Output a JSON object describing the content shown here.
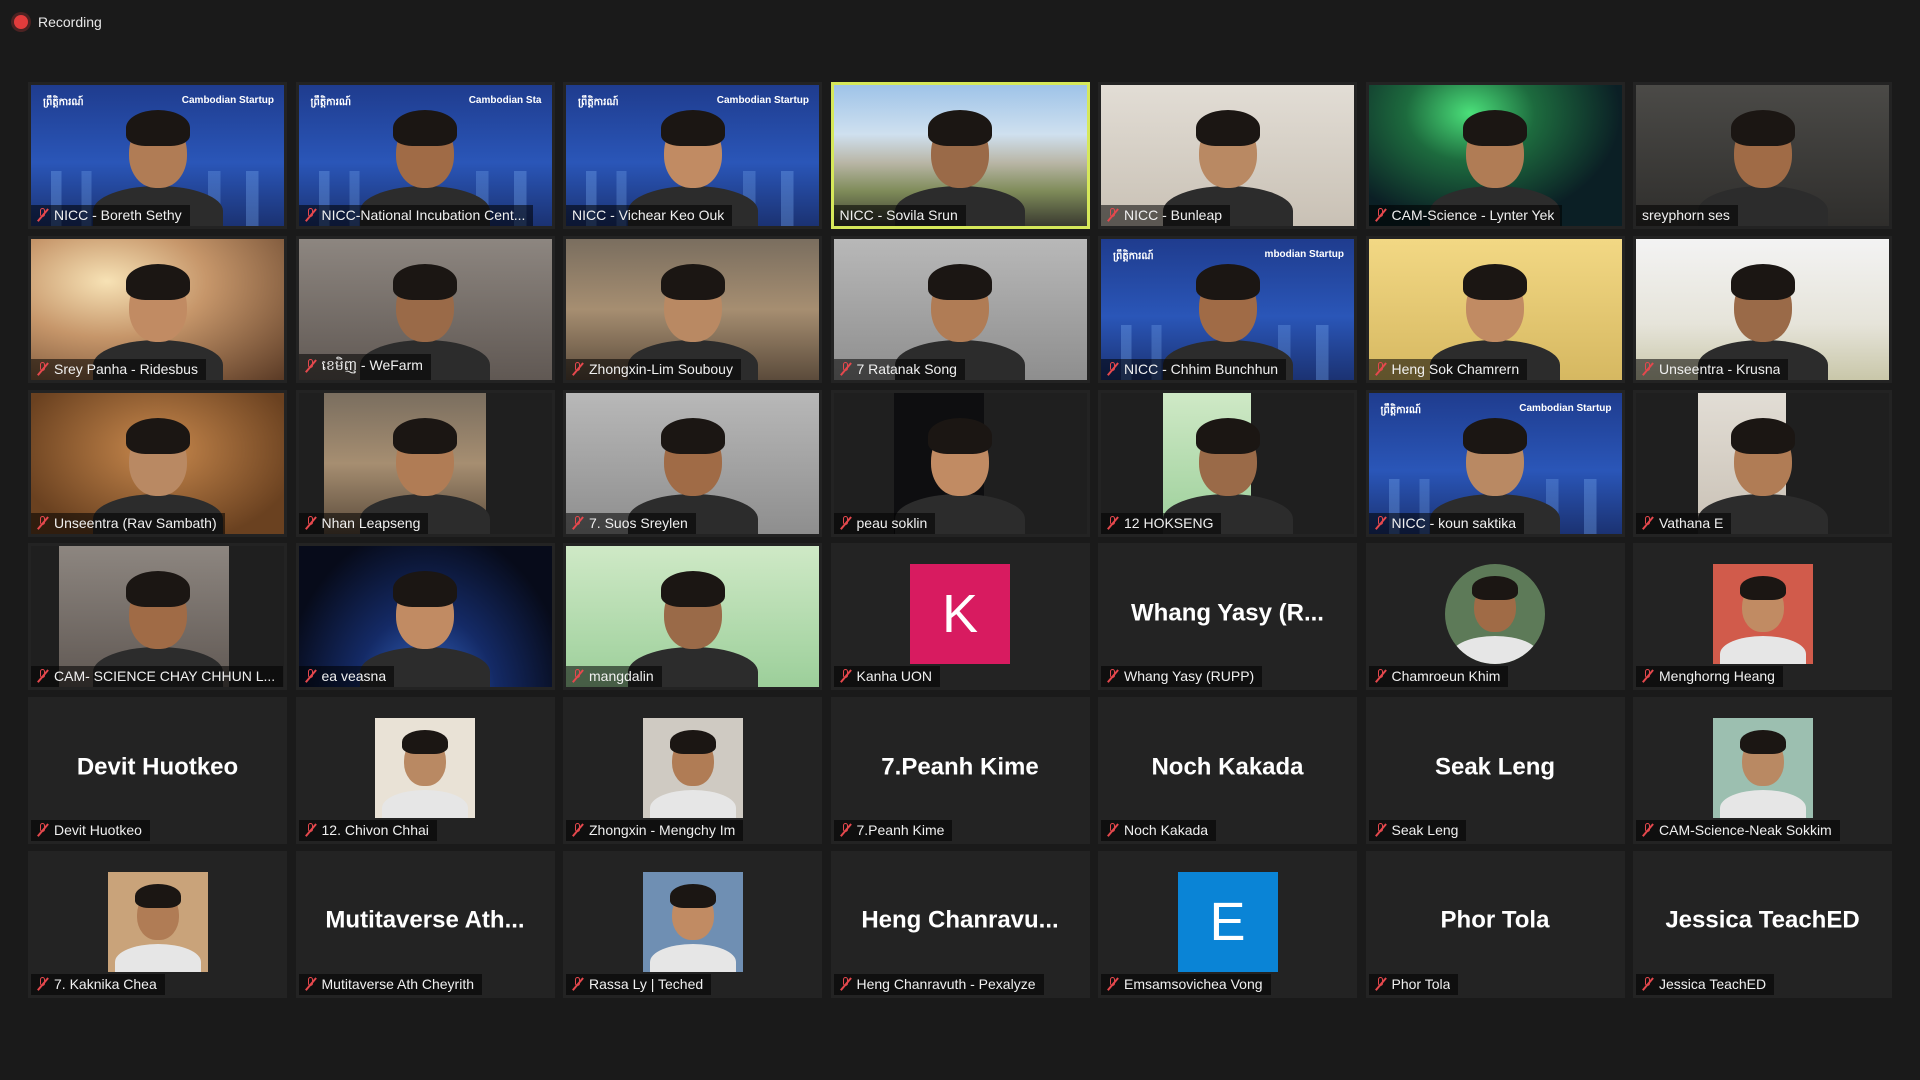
{
  "recording": {
    "label": "Recording"
  },
  "participants": [
    {
      "name": "NICC - Boreth Sethy",
      "kind": "video",
      "scene": "blue",
      "muted": true,
      "banner_l": "ព្រឹត្តិការណ៍",
      "banner_r": "Cambodian Startup"
    },
    {
      "name": "NICC-National Incubation Cent...",
      "kind": "video",
      "scene": "blue",
      "muted": true,
      "banner_l": "ព្រឹត្តិការណ៍",
      "banner_r": "Cambodian Sta"
    },
    {
      "name": "NICC - Vichear Keo Ouk",
      "kind": "video",
      "scene": "blue",
      "muted": false,
      "banner_l": "ព្រឹត្តិការណ៍",
      "banner_r": "Cambodian Startup"
    },
    {
      "name": "NICC - Sovila Srun",
      "kind": "video",
      "scene": "campus",
      "muted": false,
      "active": true
    },
    {
      "name": "NICC - Bunleap",
      "kind": "video",
      "scene": "wall",
      "muted": true
    },
    {
      "name": "CAM-Science - Lynter Yek",
      "kind": "video",
      "scene": "aurora",
      "muted": true
    },
    {
      "name": "sreyphorn ses",
      "kind": "video",
      "scene": "dim",
      "muted": false
    },
    {
      "name": "Srey Panha - Ridesbus",
      "kind": "video",
      "scene": "warm",
      "muted": true
    },
    {
      "name": "ខេមិញ - WeFarm",
      "kind": "video",
      "scene": "room",
      "muted": true
    },
    {
      "name": "Zhongxin-Lim Soubouy",
      "kind": "video",
      "scene": "shelf",
      "muted": true
    },
    {
      "name": "7 Ratanak Song",
      "kind": "video",
      "scene": "grey",
      "muted": true
    },
    {
      "name": "NICC - Chhim Bunchhun",
      "kind": "video",
      "scene": "blue",
      "muted": true,
      "banner_l": "ព្រឹត្តិការណ៍",
      "banner_r": "mbodian Startup"
    },
    {
      "name": "Heng Sok Chamrern",
      "kind": "video",
      "scene": "yellow",
      "muted": true
    },
    {
      "name": "Unseentra - Krusna",
      "kind": "video",
      "scene": "temple",
      "muted": true
    },
    {
      "name": "Unseentra (Rav Sambath)",
      "kind": "video",
      "scene": "amber",
      "muted": true
    },
    {
      "name": "Nhan Leapseng",
      "kind": "video",
      "scene": "shelf",
      "muted": true,
      "inset": [
        25,
        187
      ]
    },
    {
      "name": "7. Suos Sreylen",
      "kind": "video",
      "scene": "grey",
      "muted": true
    },
    {
      "name": "peau soklin",
      "kind": "video",
      "scene": "dark",
      "muted": true,
      "inset": [
        60,
        150
      ]
    },
    {
      "name": "12 HOKSENG",
      "kind": "video",
      "scene": "green",
      "muted": true,
      "inset": [
        62,
        150
      ]
    },
    {
      "name": "NICC - koun saktika",
      "kind": "video",
      "scene": "blue",
      "muted": true,
      "banner_l": "ព្រឹត្តិការណ៍",
      "banner_r": "Cambodian Startup"
    },
    {
      "name": "Vathana E",
      "kind": "video",
      "scene": "wall",
      "muted": true,
      "inset": [
        62,
        150
      ]
    },
    {
      "name": "CAM- SCIENCE CHAY CHHUN L...",
      "kind": "video",
      "scene": "room",
      "muted": true,
      "inset": [
        28,
        198
      ]
    },
    {
      "name": "ea veasna",
      "kind": "video",
      "scene": "space",
      "muted": true
    },
    {
      "name": "mangdalin",
      "kind": "video",
      "scene": "green",
      "muted": true
    },
    {
      "name": "Kanha UON",
      "kind": "avatar-letter",
      "letter": "K",
      "color": "#d81b60",
      "muted": true
    },
    {
      "name": "Whang Yasy (RUPP)",
      "kind": "name",
      "display": "Whang Yasy (R...",
      "muted": true
    },
    {
      "name": "Chamroeun Khim",
      "kind": "avatar-photo",
      "circle": true,
      "color": "#5d7a58",
      "muted": true
    },
    {
      "name": "Menghorng Heang",
      "kind": "avatar-photo",
      "color": "#d15b4b",
      "muted": true
    },
    {
      "name": "Devit Huotkeo",
      "kind": "name",
      "display": "Devit Huotkeo",
      "muted": true
    },
    {
      "name": "12. Chivon Chhai",
      "kind": "avatar-photo",
      "color": "#e9e2d6",
      "muted": true
    },
    {
      "name": "Zhongxin - Mengchy Im",
      "kind": "avatar-photo",
      "color": "#cfcac2",
      "muted": true
    },
    {
      "name": "7.Peanh Kime",
      "kind": "name",
      "display": "7.Peanh Kime",
      "muted": true
    },
    {
      "name": "Noch Kakada",
      "kind": "name",
      "display": "Noch Kakada",
      "muted": true
    },
    {
      "name": "Seak Leng",
      "kind": "name",
      "display": "Seak Leng",
      "muted": true
    },
    {
      "name": "CAM-Science-Neak Sokkim",
      "kind": "avatar-photo",
      "color": "#9cbfb0",
      "muted": true
    },
    {
      "name": "7. Kaknika Chea",
      "kind": "avatar-photo",
      "color": "#c9a37a",
      "muted": true
    },
    {
      "name": "Mutitaverse Ath Cheyrith",
      "kind": "name",
      "display": "Mutitaverse  Ath...",
      "muted": true
    },
    {
      "name": "Rassa Ly | Teched",
      "kind": "avatar-photo",
      "color": "#6f8fb3",
      "muted": true
    },
    {
      "name": "Heng Chanravuth - Pexalyze",
      "kind": "name",
      "display": "Heng  Chanravu...",
      "muted": true
    },
    {
      "name": "Emsamsovichea Vong",
      "kind": "avatar-letter",
      "letter": "E",
      "color": "#0a84d6",
      "muted": true
    },
    {
      "name": "Phor Tola",
      "kind": "name",
      "display": "Phor Tola",
      "muted": true
    },
    {
      "name": "Jessica TeachED",
      "kind": "name",
      "display": "Jessica TeachED",
      "muted": true
    }
  ]
}
